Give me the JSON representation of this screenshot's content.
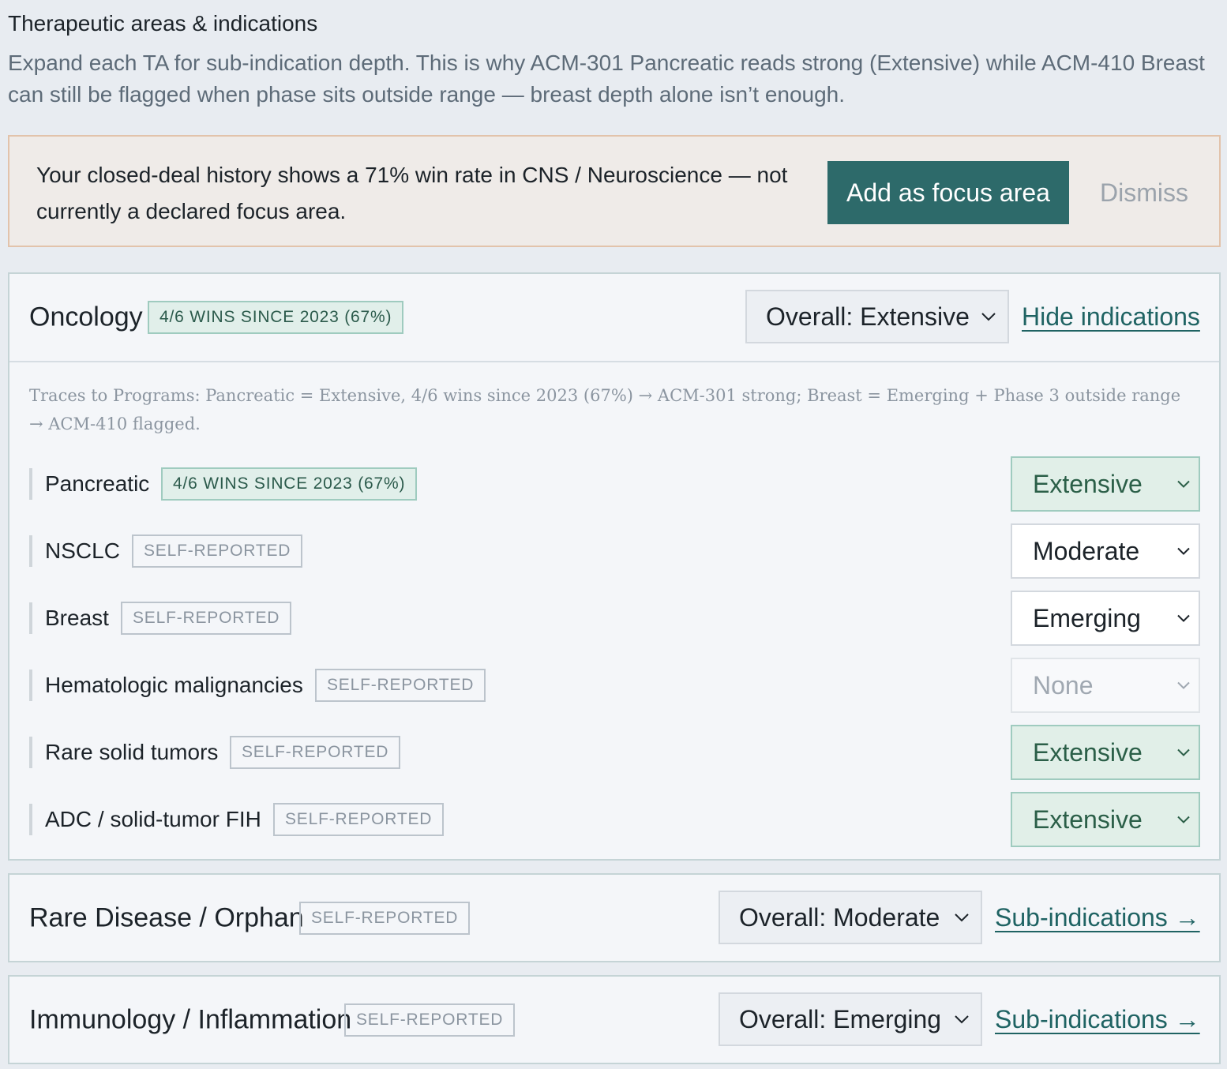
{
  "section": {
    "title": "Therapeutic areas & indications",
    "description": "Expand each TA for sub-indication depth. This is why ACM-301 Pancreatic reads strong (Extensive) while ACM-410 Breast can still be flagged when phase sits outside range — breast depth alone isn’t enough."
  },
  "banner": {
    "text": "Your closed-deal history shows a 71% win rate in CNS / Neuroscience — not currently a declared focus area.",
    "primary_label": "Add as focus area",
    "dismiss_label": "Dismiss"
  },
  "oncology": {
    "name": "Oncology",
    "badge": "4/6 WINS SINCE 2023 (67%)",
    "overall": "Overall: Extensive",
    "toggle_link": "Hide indications",
    "trace": "Traces to Programs: Pancreatic = Extensive, 4/6 wins since 2023 (67%) → ACM-301 strong; Breast = Emerging + Phase 3 outside range → ACM-410 flagged.",
    "indications": [
      {
        "name": "Pancreatic",
        "badge": "4/6 WINS SINCE 2023 (67%)",
        "depth": "Extensive"
      },
      {
        "name": "NSCLC",
        "badge": "SELF-REPORTED",
        "depth": "Moderate"
      },
      {
        "name": "Breast",
        "badge": "SELF-REPORTED",
        "depth": "Emerging"
      },
      {
        "name": "Hematologic malignancies",
        "badge": "SELF-REPORTED",
        "depth": "None"
      },
      {
        "name": "Rare solid tumors",
        "badge": "SELF-REPORTED",
        "depth": "Extensive"
      },
      {
        "name": "ADC / solid-tumor FIH",
        "badge": "SELF-REPORTED",
        "depth": "Extensive"
      }
    ]
  },
  "rare_disease": {
    "name": "Rare Disease / Orphan",
    "badge": "SELF-REPORTED",
    "overall": "Overall: Moderate",
    "link": "Sub-indications →"
  },
  "immunology": {
    "name": "Immunology / Inflammation",
    "badge": "SELF-REPORTED",
    "overall": "Overall: Emerging",
    "link": "Sub-indications →"
  },
  "colors": {
    "accent": "#2d6a6a",
    "banner_bg": "#efebe8",
    "banner_border": "#e2c3ab",
    "evidence_badge_bg": "#e1efea",
    "link": "#1f6363"
  }
}
